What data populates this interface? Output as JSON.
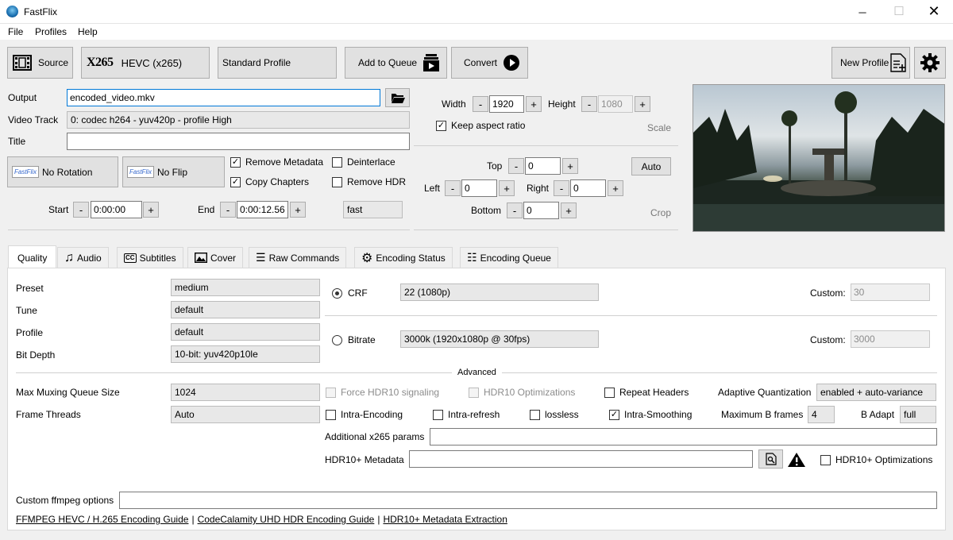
{
  "window": {
    "title": "FastFlix"
  },
  "menu": [
    "File",
    "Profiles",
    "Help"
  ],
  "toolbar": {
    "source": "Source",
    "encoder_logo": "X265",
    "encoder": "HEVC (x265)",
    "profile": "Standard Profile",
    "add_to_queue": "Add to Queue",
    "convert": "Convert",
    "new_profile": "New Profile"
  },
  "main": {
    "output_label": "Output",
    "output_value": "encoded_video.mkv",
    "video_track_label": "Video Track",
    "video_track_value": "0: codec h264 - yuv420p - profile High",
    "title_label": "Title",
    "title_value": "",
    "rotation": "No Rotation",
    "flip": "No Flip",
    "rotation_logo": "FastFlix",
    "flip_logo": "FastFlix",
    "remove_metadata": "Remove Metadata",
    "copy_chapters": "Copy Chapters",
    "deinterlace": "Deinterlace",
    "remove_hdr": "Remove HDR",
    "start_label": "Start",
    "start_value": "0:00:00",
    "end_label": "End",
    "end_value": "0:00:12.56",
    "speed": "fast"
  },
  "scale": {
    "width_label": "Width",
    "width_value": "1920",
    "height_label": "Height",
    "height_value": "1080",
    "keep_aspect": "Keep aspect ratio",
    "title": "Scale"
  },
  "crop": {
    "top_label": "Top",
    "top_value": "0",
    "left_label": "Left",
    "left_value": "0",
    "right_label": "Right",
    "right_value": "0",
    "bottom_label": "Bottom",
    "bottom_value": "0",
    "auto": "Auto",
    "title": "Crop"
  },
  "tabs": [
    "Quality",
    "Audio",
    "Subtitles",
    "Cover",
    "Raw Commands",
    "Encoding Status",
    "Encoding Queue"
  ],
  "quality": {
    "preset_label": "Preset",
    "preset_value": "medium",
    "tune_label": "Tune",
    "tune_value": "default",
    "profile_label": "Profile",
    "profile_value": "default",
    "bitdepth_label": "Bit Depth",
    "bitdepth_value": "10-bit: yuv420p10le",
    "crf_label": "CRF",
    "crf_value": "22 (1080p)",
    "bitrate_label": "Bitrate",
    "bitrate_value": "3000k   (1920x1080p @ 30fps)",
    "custom_label": "Custom:",
    "crf_custom": "30",
    "bitrate_custom": "3000",
    "advanced": "Advanced",
    "max_mux_label": "Max Muxing Queue Size",
    "max_mux_value": "1024",
    "frame_threads_label": "Frame Threads",
    "frame_threads_value": "Auto",
    "force_hdr10": "Force HDR10 signaling",
    "hdr10_opt": "HDR10 Optimizations",
    "repeat_headers": "Repeat Headers",
    "aq_label": "Adaptive Quantization",
    "aq_value": "enabled + auto-variance",
    "intra_encoding": "Intra-Encoding",
    "intra_refresh": "Intra-refresh",
    "lossless": "lossless",
    "intra_smoothing": "Intra-Smoothing",
    "max_b_label": "Maximum B frames",
    "max_b_value": "4",
    "b_adapt_label": "B Adapt",
    "b_adapt_value": "full",
    "additional_label": "Additional x265 params",
    "additional_value": "",
    "hdr10plus_label": "HDR10+ Metadata",
    "hdr10plus_value": "",
    "hdr10plus_opt": "HDR10+ Optimizations",
    "custom_ffmpeg_label": "Custom ffmpeg options",
    "custom_ffmpeg_value": ""
  },
  "links": {
    "l1": "FFMPEG HEVC / H.265 Encoding Guide",
    "sep1": "|",
    "l2": "CodeCalamity UHD HDR Encoding Guide",
    "sep2": "|",
    "l3": "HDR10+ Metadata Extraction"
  }
}
